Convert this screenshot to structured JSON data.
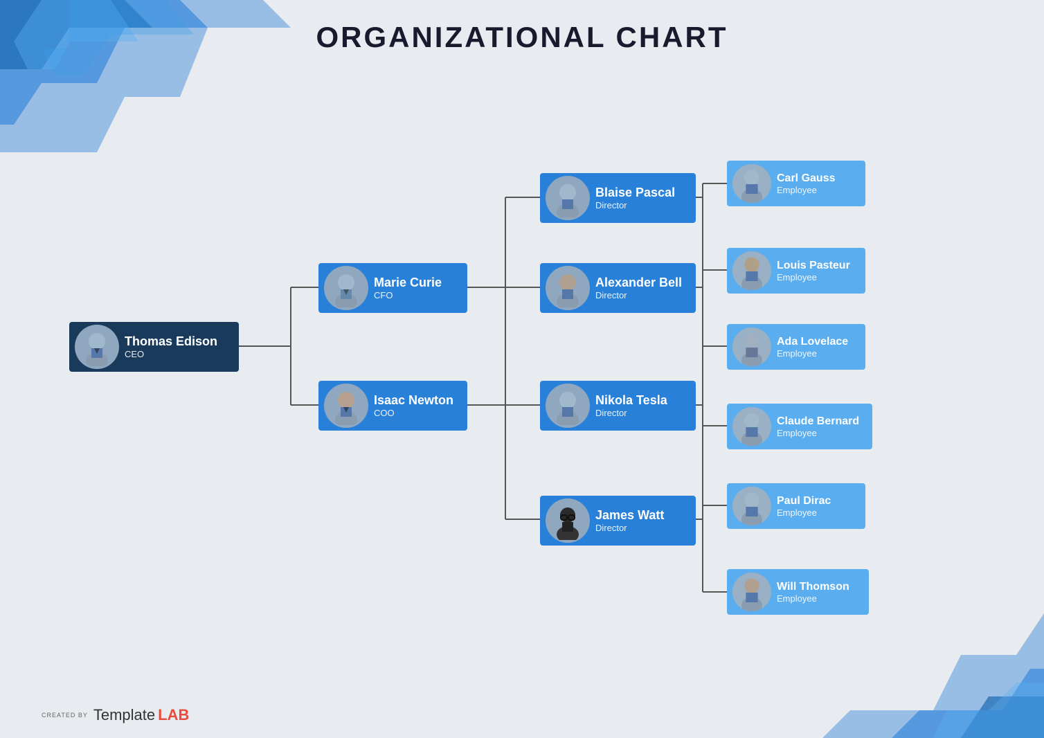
{
  "page": {
    "title": "ORGANIZATIONAL CHART",
    "background_color": "#e8ecf0"
  },
  "nodes": {
    "ceo": {
      "name": "Thomas Edison",
      "role": "CEO",
      "avatar_type": "male_suit_dark"
    },
    "cfo": {
      "name": "Marie Curie",
      "role": "CFO",
      "avatar_type": "female_suit"
    },
    "coo": {
      "name": "Isaac Newton",
      "role": "COO",
      "avatar_type": "male_casual"
    },
    "director1": {
      "name": "Blaise Pascal",
      "role": "Director",
      "avatar_type": "male_suit"
    },
    "director2": {
      "name": "Alexander Bell",
      "role": "Director",
      "avatar_type": "male_suit2"
    },
    "director3": {
      "name": "Nikola Tesla",
      "role": "Director",
      "avatar_type": "male_suit3"
    },
    "director4": {
      "name": "James Watt",
      "role": "Director",
      "avatar_type": "male_glasses"
    },
    "emp1": {
      "name": "Carl Gauss",
      "role": "Employee",
      "avatar_type": "male_emp1"
    },
    "emp2": {
      "name": "Louis Pasteur",
      "role": "Employee",
      "avatar_type": "male_emp2"
    },
    "emp3": {
      "name": "Ada Lovelace",
      "role": "Employee",
      "avatar_type": "female_emp"
    },
    "emp4": {
      "name": "Claude Bernard",
      "role": "Employee",
      "avatar_type": "male_emp3"
    },
    "emp5": {
      "name": "Paul Dirac",
      "role": "Employee",
      "avatar_type": "male_emp4"
    },
    "emp6": {
      "name": "Will Thomson",
      "role": "Employee",
      "avatar_type": "male_emp5"
    }
  },
  "footer": {
    "created_by": "CREATED BY",
    "brand_regular": "Template",
    "brand_bold": "LAB"
  }
}
